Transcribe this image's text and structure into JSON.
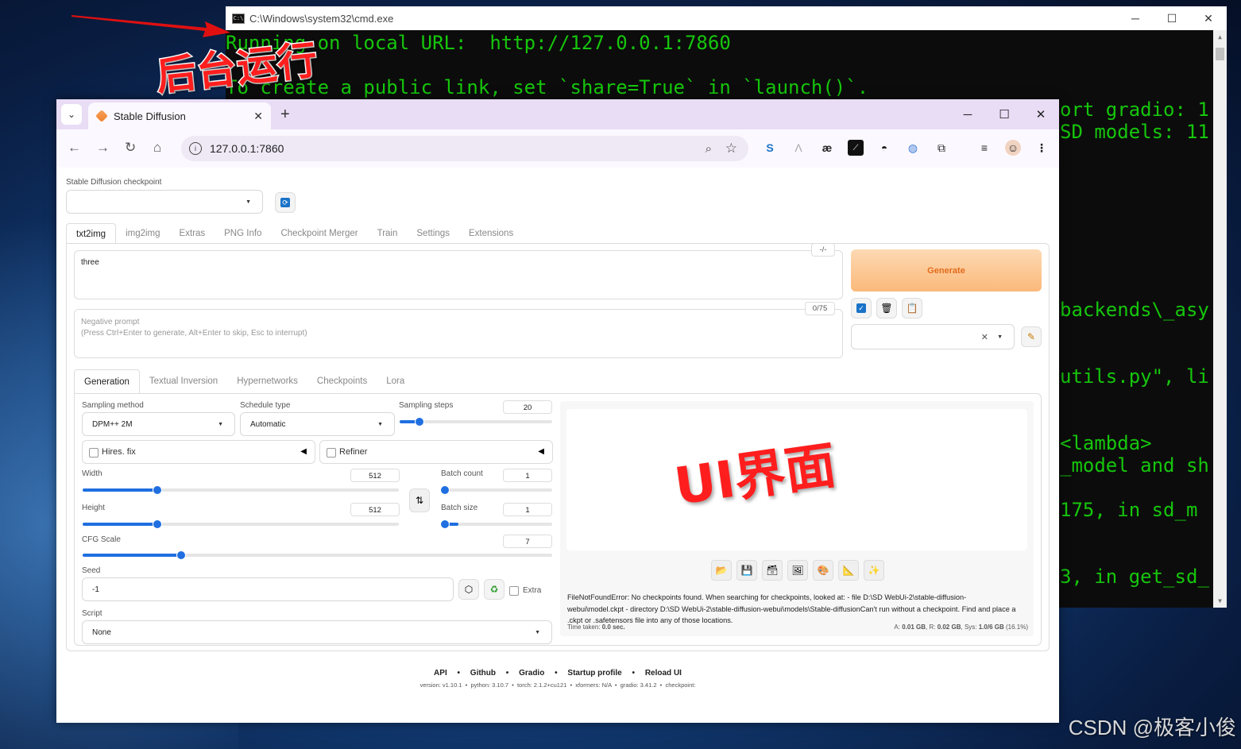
{
  "cmd": {
    "title": "C:\\Windows\\system32\\cmd.exe",
    "line1": "Running on local URL:  http://127.0.0.1:7860",
    "line2": "To create a public link, set `share=True` in `launch()`.",
    "right_lines": [
      "ort gradio: 1",
      "SD models: 11",
      "backends\\_asy",
      "utils.py\", li",
      "<lambda>",
      "_model and sh",
      "175, in sd_m",
      "3, in get_sd_"
    ]
  },
  "annotations": {
    "background_label": "后台运行",
    "ui_label": "UI界面"
  },
  "watermark": "CSDN @极客小俊",
  "browser": {
    "tab_title": "Stable Diffusion",
    "url": "127.0.0.1:7860"
  },
  "page": {
    "checkpoint_label": "Stable Diffusion checkpoint",
    "checkpoint_value": "",
    "main_tabs": [
      "txt2img",
      "img2img",
      "Extras",
      "PNG Info",
      "Checkpoint Merger",
      "Train",
      "Settings",
      "Extensions"
    ],
    "prompt": "three",
    "prompt_counter": "-/-",
    "negative_counter": "0/75",
    "negative_placeholder": "Negative prompt",
    "negative_hint": "(Press Ctrl+Enter to generate, Alt+Enter to skip, Esc to interrupt)",
    "generate_label": "Generate",
    "sub_tabs": [
      "Generation",
      "Textual Inversion",
      "Hypernetworks",
      "Checkpoints",
      "Lora"
    ],
    "sampling_method_label": "Sampling method",
    "sampling_method_value": "DPM++ 2M",
    "schedule_type_label": "Schedule type",
    "schedule_type_value": "Automatic",
    "sampling_steps_label": "Sampling steps",
    "sampling_steps_value": "20",
    "sampling_steps_fraction": 0.13,
    "hires_label": "Hires. fix",
    "refiner_label": "Refiner",
    "width_label": "Width",
    "width_value": "512",
    "width_fraction": 0.235,
    "height_label": "Height",
    "height_value": "512",
    "height_fraction": 0.235,
    "batch_count_label": "Batch count",
    "batch_count_value": "1",
    "batch_size_label": "Batch size",
    "batch_size_value": "1",
    "cfg_label": "CFG Scale",
    "cfg_value": "7",
    "cfg_fraction": 0.21,
    "seed_label": "Seed",
    "seed_value": "-1",
    "extra_label": "Extra",
    "script_label": "Script",
    "script_value": "None",
    "error_text": "FileNotFoundError: No checkpoints found. When searching for checkpoints, looked at: - file D:\\SD WebUi-2\\stable-diffusion-webui\\model.ckpt - directory D:\\SD WebUi-2\\stable-diffusion-webui\\models\\Stable-diffusionCan't run without a checkpoint. Find and place a .ckpt or .safetensors file into any of those locations.",
    "time_taken_label": "Time taken:",
    "time_taken_value": "0.0 sec.",
    "mem_a_label": "A:",
    "mem_a": "0.01 GB",
    "mem_r_label": "R:",
    "mem_r": "0.02 GB",
    "mem_sys_label": "Sys:",
    "mem_sys": "1.0/6 GB",
    "mem_sys_pct": "(16.1%)",
    "footer_links": [
      "API",
      "Github",
      "Gradio",
      "Startup profile",
      "Reload UI"
    ],
    "footer_version": "version: v1.10.1  •  python: 3.10.7  •  torch: 2.1.2+cu121  •  xformers: N/A  •  gradio: 3.41.2  •  checkpoint:"
  }
}
